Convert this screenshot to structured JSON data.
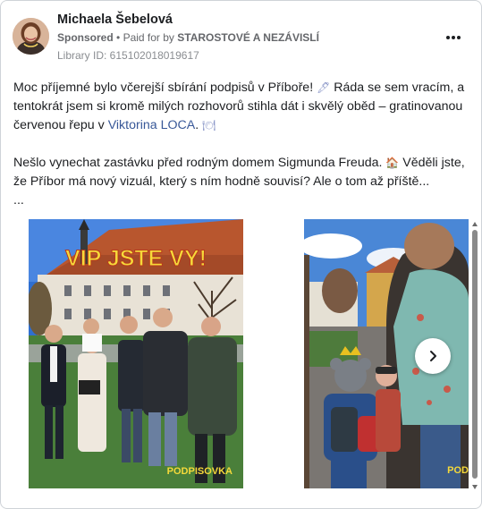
{
  "post": {
    "author": "Michaela Šebelová",
    "sponsored": "Sponsored",
    "dot": "•",
    "paid_for_by": "Paid for by",
    "payer": "STAROSTOVÉ A NEZÁVISLÍ",
    "library_id": "Library ID: 615102018019617"
  },
  "text": {
    "p1_a": "Moc příjemné bylo včerejší sbírání podpisů v Příboře! ",
    "p1_b": " Ráda se sem vracím, a tentokrát jsem si kromě milých rozhovorů stihla dát i skvělý oběd – gratinovanou červenou řepu v ",
    "p1_link": "Viktorina LOCA",
    "p1_c": ". ",
    "p2_a": "Nešlo vynechat zastávku před rodným domem Sigmunda Freuda. ",
    "p2_b": " Věděli jste, že Příbor má nový vizuál, který s ním hodně souvisí? Ale o tom až příště...",
    "more": "..."
  },
  "images": {
    "slide1_headline": "VIP JSTE VY!",
    "slide1_tag": "PODPISOVKA",
    "slide2_tag": "POD"
  },
  "icons": {
    "more": "more-horizontal-icon",
    "next": "chevron-right-icon",
    "pen": "pen-emoji-icon",
    "plate": "plate-emoji-icon",
    "house": "house-emoji-icon"
  },
  "colors": {
    "link": "#385898",
    "meta": "#65676b",
    "headline_yellow": "#f5d93a"
  }
}
